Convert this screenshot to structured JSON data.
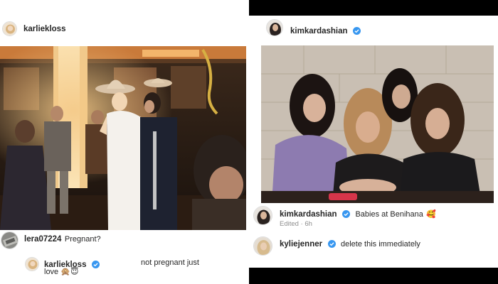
{
  "left_post": {
    "author": "karliekloss",
    "comments": [
      {
        "username": "lera07224",
        "text": "Pregnant?",
        "verified": false
      },
      {
        "username": "karliekloss",
        "text": "not pregnant just",
        "text_cont": "love",
        "emojis": "🙊😇",
        "verified": true
      }
    ]
  },
  "right_post": {
    "author": "kimkardashian",
    "author_verified": true,
    "caption": {
      "username": "kimkardashian",
      "text": "Babies at Benihana",
      "emoji": "🥰",
      "meta": "Edited · 6h"
    },
    "comments": [
      {
        "username": "kyliejenner",
        "text": "delete this immediately",
        "verified": true
      }
    ]
  },
  "colors": {
    "verified_blue": "#3897f0",
    "meta_gray": "#8e8e8e"
  },
  "icons": {
    "verified": "verified-badge-icon"
  }
}
